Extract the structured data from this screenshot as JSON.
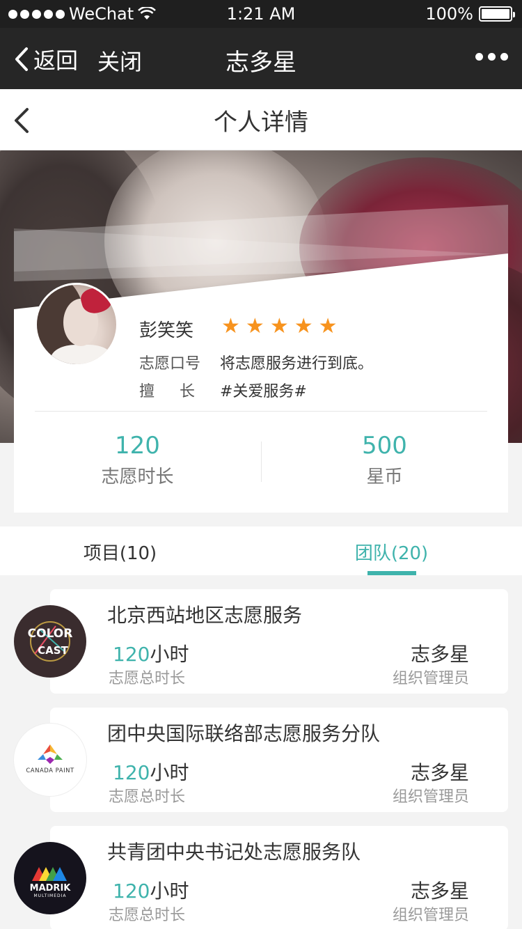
{
  "status_bar": {
    "carrier": "WeChat",
    "time": "1:21 AM",
    "battery": "100%"
  },
  "wechat_nav": {
    "back": "返回",
    "close": "关闭",
    "title": "志多星"
  },
  "page": {
    "title": "个人详情"
  },
  "profile": {
    "name": "彭笑笑",
    "rating": 5,
    "slogan_label": "志愿口号",
    "slogan": "将志愿服务进行到底。",
    "specialty_label": "擅长",
    "specialty": "#关爱服务#",
    "stats": [
      {
        "value": "120",
        "label": "志愿时长"
      },
      {
        "value": "500",
        "label": "星币"
      }
    ]
  },
  "tabs": [
    {
      "label": "项目(10)",
      "active": false
    },
    {
      "label": "团队(20)",
      "active": true
    }
  ],
  "teams": [
    {
      "name": "北京西站地区志愿服务",
      "hours": "120",
      "hours_unit": "小时",
      "hours_label": "志愿总时长",
      "org": "志多星",
      "role": "组织管理员",
      "logo": "color-cast-logo"
    },
    {
      "name": "团中央国际联络部志愿服务分队",
      "hours": "120",
      "hours_unit": "小时",
      "hours_label": "志愿总时长",
      "org": "志多星",
      "role": "组织管理员",
      "logo": "canada-paint-logo"
    },
    {
      "name": "共青团中央书记处志愿服务队",
      "hours": "120",
      "hours_unit": "小时",
      "hours_label": "志愿总时长",
      "org": "志多星",
      "role": "组织管理员",
      "logo": "madrik-logo"
    }
  ],
  "logos": {
    "colorcast_line1": "COLOR",
    "colorcast_line2": "CAST",
    "canada": "CANADA PAINT",
    "madrik": "MADRIK",
    "madrik_sub": "MULTIMEDIA"
  },
  "colors": {
    "accent": "#3fb3ac",
    "star": "#f7931e",
    "nav_bg": "#262626",
    "status_bg": "#1f1f1f"
  }
}
